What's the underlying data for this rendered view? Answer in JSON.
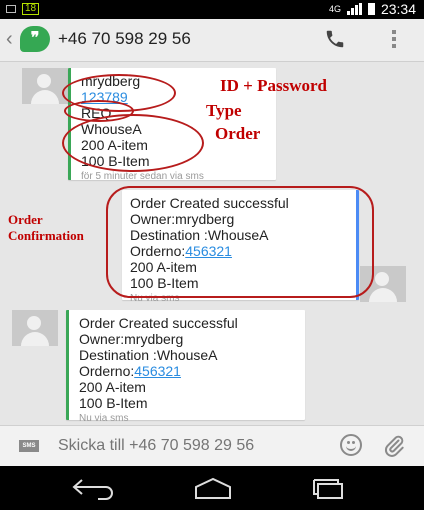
{
  "status_bar": {
    "time": "23:34",
    "network": "4G",
    "notification_badge": "18"
  },
  "app_bar": {
    "contact": "+46 70 598 29 56"
  },
  "messages": [
    {
      "sender": "mrydberg",
      "lines": [
        "123789",
        "REQ",
        "WhouseA",
        "200 A-item",
        "100 B-Item"
      ],
      "meta": "för 5 minuter sedan via sms"
    },
    {
      "lines": [
        "Order Created successful",
        "Owner:mrydberg",
        "Destination :WhouseA",
        "Orderno:456321",
        "200 A-item",
        "100 B-Item"
      ],
      "meta": "Nu via sms"
    },
    {
      "lines": [
        "Order Created successful",
        "Owner:mrydberg",
        "Destination :WhouseA",
        "Orderno:456321",
        "200 A-item",
        "100 B-Item"
      ],
      "meta": "Nu via sms"
    }
  ],
  "annotations": {
    "id_password": "ID + Password",
    "type": "Type",
    "order": "Order",
    "confirmation_1": "Order",
    "confirmation_2": "Confirmation"
  },
  "composer": {
    "placeholder": "Skicka till +46 70 598 29 56",
    "sms_label": "SMS"
  },
  "colors": {
    "annotation": "#c00000",
    "hangouts_green": "#35a853",
    "link": "#2a8ce0"
  },
  "icons": [
    "back-icon",
    "hangouts-logo-icon",
    "phone-icon",
    "overflow-menu-icon",
    "avatar-icon",
    "sms-icon",
    "emoji-icon",
    "attach-icon",
    "nav-back-icon",
    "nav-home-icon",
    "nav-recents-icon"
  ]
}
